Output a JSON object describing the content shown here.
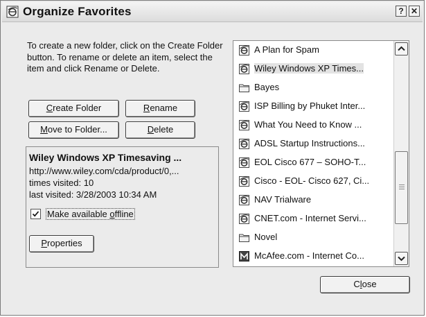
{
  "window": {
    "title": "Organize Favorites",
    "help_button": "?",
    "close_button": "✕"
  },
  "instructions": "To create a new folder, click on the Create Folder button. To rename or delete an item, select the item and click Rename or Delete.",
  "buttons": {
    "create_folder": {
      "accel": "C",
      "rest": "reate Folder"
    },
    "rename": {
      "accel": "R",
      "rest": "ename"
    },
    "move_to_folder": {
      "accel": "M",
      "rest": "ove to Folder..."
    },
    "delete": {
      "accel": "D",
      "rest": "elete"
    },
    "properties": {
      "accel": "P",
      "rest": "roperties"
    },
    "close": {
      "before": "C",
      "accel": "l",
      "rest": "ose"
    }
  },
  "details": {
    "name": "Wiley Windows XP Timesaving ...",
    "url": "http://www.wiley.com/cda/product/0,...",
    "times_visited": "times visited: 10",
    "last_visited": "last visited: 3/28/2003 10:34 AM",
    "offline_checkbox": {
      "before": "Make available ",
      "accel": "o",
      "rest": "ffline",
      "checked": true
    }
  },
  "favorites": [
    {
      "label": "A Plan for Spam",
      "icon": "ie-page-icon",
      "selected": false
    },
    {
      "label": "Wiley  Windows XP Times...",
      "icon": "ie-page-icon",
      "selected": true
    },
    {
      "label": "Bayes",
      "icon": "folder-icon",
      "selected": false
    },
    {
      "label": "ISP Billing by Phuket Inter...",
      "icon": "ie-page-icon",
      "selected": false
    },
    {
      "label": "What You Need to Know ...",
      "icon": "ie-page-icon",
      "selected": false
    },
    {
      "label": "ADSL Startup Instructions...",
      "icon": "ie-page-icon",
      "selected": false
    },
    {
      "label": "EOL Cisco 677 – SOHO-T...",
      "icon": "ie-page-icon",
      "selected": false
    },
    {
      "label": "Cisco - EOL- Cisco 627, Ci...",
      "icon": "ie-page-icon",
      "selected": false
    },
    {
      "label": "NAV Trialware",
      "icon": "ie-page-icon",
      "selected": false
    },
    {
      "label": "CNET.com - Internet Servi...",
      "icon": "ie-page-icon",
      "selected": false
    },
    {
      "label": "Novel",
      "icon": "folder-icon",
      "selected": false
    },
    {
      "label": "McAfee.com - Internet Co...",
      "icon": "mcafee-icon",
      "selected": false
    }
  ]
}
